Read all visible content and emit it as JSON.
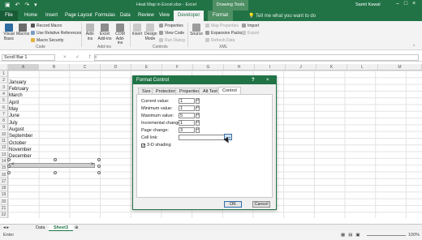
{
  "window": {
    "title": "Heat Map in Excel.xlsx - Excel",
    "context_tab_group": "Drawing Tools",
    "user": "Samit Kawal"
  },
  "tabs": [
    "File",
    "Home",
    "Insert",
    "Page Layout",
    "Formulas",
    "Data",
    "Review",
    "View",
    "Developer",
    "Format"
  ],
  "tell_me": "Tell me what you want to do",
  "ribbon": {
    "code": {
      "visual_basic": "Visual Basic",
      "macros": "Macros",
      "record_macro": "Record Macro",
      "use_relative": "Use Relative References",
      "macro_security": "Macro Security",
      "label": "Code"
    },
    "addins": {
      "add_ins": "Add-ins",
      "excel_add_ins": "Excel Add-ins",
      "com_add_ins": "COM Add-ins",
      "label": "Add-ins"
    },
    "controls": {
      "insert": "Insert",
      "design_mode": "Design Mode",
      "properties": "Properties",
      "view_code": "View Code",
      "run_dialog": "Run Dialog",
      "label": "Controls"
    },
    "xml": {
      "source": "Source",
      "map_properties": "Map Properties",
      "expansion_packs": "Expansion Packs",
      "refresh_data": "Refresh Data",
      "import": "Import",
      "export": "Export",
      "label": "XML"
    }
  },
  "formula_bar": {
    "name_box": "Scroll Bar 1",
    "fx_icons": "× ✓ fx"
  },
  "columns": [
    "A",
    "B",
    "C",
    "D",
    "E",
    "F",
    "G",
    "H",
    "I",
    "J",
    "K",
    "L",
    "M"
  ],
  "rows": [
    "1",
    "2",
    "3",
    "4",
    "5",
    "6",
    "7",
    "8",
    "9",
    "10",
    "11",
    "12",
    "13",
    "14",
    "15",
    "16",
    "17",
    "18",
    "19",
    "20",
    "21",
    "22"
  ],
  "cells": [
    "January",
    "February",
    "March",
    "April",
    "May",
    "June",
    "July",
    "August",
    "September",
    "October",
    "November",
    "December"
  ],
  "scrollbar_arrows": {
    "left": "<",
    "right": ">"
  },
  "dialog": {
    "title": "Format Control",
    "help": "?",
    "close": "×",
    "tabs": [
      "Size",
      "Protection",
      "Properties",
      "Alt Text",
      "Control"
    ],
    "fields": [
      {
        "label": "Current value:",
        "value": "1"
      },
      {
        "label": "Minimum value:",
        "value": "1"
      },
      {
        "label": "Maximum value:",
        "value": "5"
      },
      {
        "label": "Incremental change:",
        "value": "1"
      },
      {
        "label": "Page change:",
        "value": "3"
      }
    ],
    "cell_link_label": "Cell link:",
    "shading_label": "3-D shading",
    "ok": "OK",
    "cancel": "Cancel"
  },
  "sheets": [
    "Data",
    "Sheet3"
  ],
  "status": {
    "left": "Enter",
    "zoom": "100%"
  },
  "colors": {
    "excel_green": "#217346"
  }
}
